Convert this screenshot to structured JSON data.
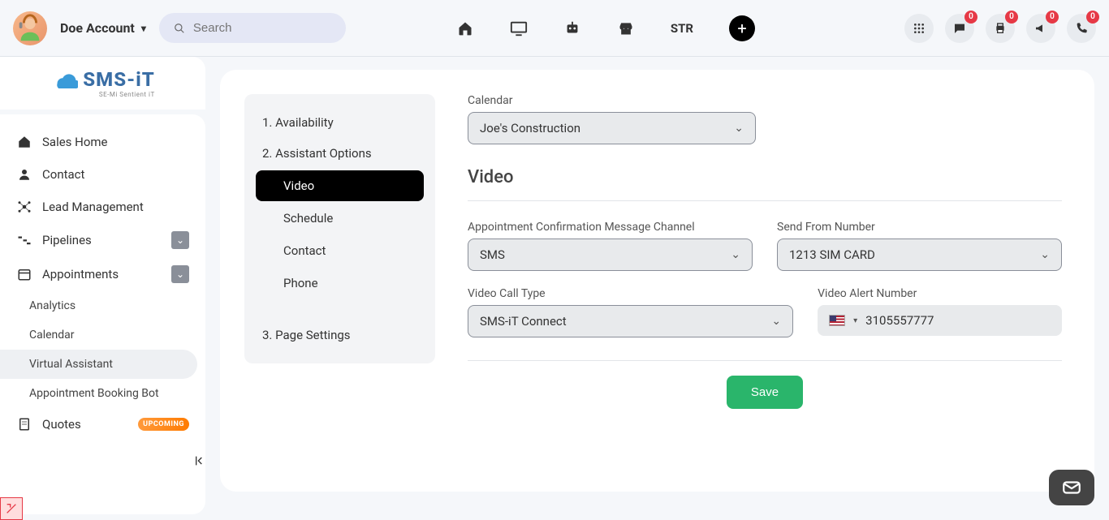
{
  "topbar": {
    "account_name": "Doe Account",
    "search_placeholder": "Search",
    "str_label": "STR",
    "badges": {
      "chat": "0",
      "print": "0",
      "announce": "0",
      "phone": "0"
    }
  },
  "logo": {
    "main": "SMS-iT",
    "sub": "SE-Mi Sentient iT"
  },
  "sidenav": {
    "sales_home": "Sales Home",
    "contact": "Contact",
    "lead_mgmt": "Lead Management",
    "pipelines": "Pipelines",
    "appointments": "Appointments",
    "analytics": "Analytics",
    "calendar": "Calendar",
    "virtual_assistant": "Virtual Assistant",
    "booking_bot": "Appointment Booking Bot",
    "quotes": "Quotes",
    "upcoming_badge": "UPCOMING"
  },
  "steps": {
    "s1": "1. Availability",
    "s2": "2. Assistant Options",
    "s2a": "Video",
    "s2b": "Schedule",
    "s2c": "Contact",
    "s2d": "Phone",
    "s3": "3. Page Settings"
  },
  "form": {
    "calendar_label": "Calendar",
    "calendar_value": "Joe's Construction",
    "section_title": "Video",
    "channel_label": "Appointment Confirmation Message Channel",
    "channel_value": "SMS",
    "send_from_label": "Send From Number",
    "send_from_value": "1213 SIM CARD",
    "call_type_label": "Video Call Type",
    "call_type_value": "SMS-iT Connect",
    "alert_label": "Video Alert Number",
    "alert_value": "3105557777",
    "save_label": "Save"
  }
}
